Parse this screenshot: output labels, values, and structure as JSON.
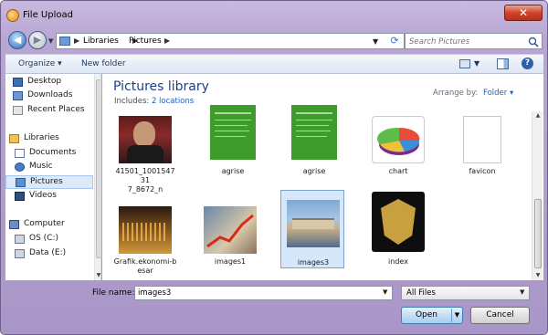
{
  "window": {
    "title": "File Upload",
    "close_label": "✕"
  },
  "nav": {
    "breadcrumb": [
      "Libraries",
      "Pictures"
    ],
    "search_placeholder": "Search Pictures"
  },
  "toolbar": {
    "organize_label": "Organize ▾",
    "new_folder_label": "New folder",
    "help_label": "?"
  },
  "sidebar": {
    "items": [
      {
        "label": "Desktop",
        "icon": "desktop-icon"
      },
      {
        "label": "Downloads",
        "icon": "downloads-icon"
      },
      {
        "label": "Recent Places",
        "icon": "recent-places-icon"
      },
      {
        "label": "Libraries",
        "icon": "libraries-icon"
      },
      {
        "label": "Documents",
        "icon": "documents-icon"
      },
      {
        "label": "Music",
        "icon": "music-icon"
      },
      {
        "label": "Pictures",
        "icon": "pictures-icon",
        "selected": true
      },
      {
        "label": "Videos",
        "icon": "videos-icon"
      },
      {
        "label": "Computer",
        "icon": "computer-icon"
      },
      {
        "label": "OS (C:)",
        "icon": "drive-icon"
      },
      {
        "label": "Data (E:)",
        "icon": "drive-icon"
      }
    ]
  },
  "library": {
    "title": "Pictures library",
    "includes_label": "Includes:",
    "includes_link": "2 locations",
    "arrange_label": "Arrange by:",
    "arrange_value": "Folder ▾"
  },
  "files": [
    {
      "name": "41501_100154731\n7_8672_n",
      "selected": false
    },
    {
      "name": "agrise",
      "selected": false
    },
    {
      "name": "agrise",
      "selected": false
    },
    {
      "name": "chart",
      "selected": false
    },
    {
      "name": "favicon",
      "selected": false
    },
    {
      "name": "Grafik.ekonomi-b\nesar",
      "selected": false
    },
    {
      "name": "images1",
      "selected": false
    },
    {
      "name": "images3",
      "selected": true
    },
    {
      "name": "index",
      "selected": false
    }
  ],
  "footer": {
    "filename_label": "File name:",
    "filename_value": "images3",
    "filter_value": "All Files",
    "open_label": "Open",
    "cancel_label": "Cancel"
  }
}
